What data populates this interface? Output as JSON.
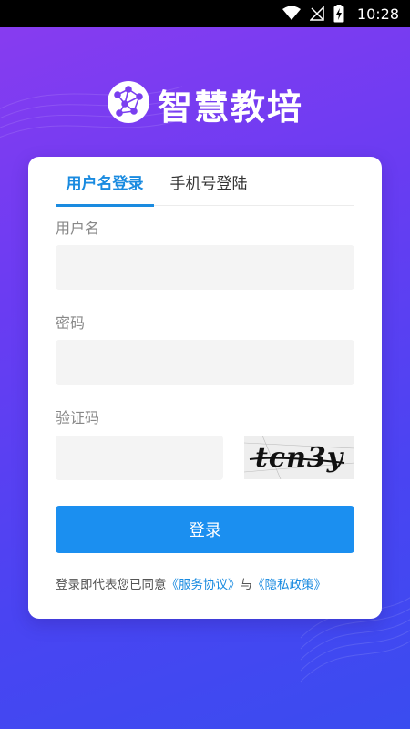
{
  "status_bar": {
    "time": "10:28",
    "icons": [
      "wifi-icon",
      "no-signal-icon",
      "battery-charging-icon"
    ]
  },
  "app": {
    "title": "智慧教培",
    "logo_icon": "network-brain-icon"
  },
  "login_tabs": [
    {
      "label": "用户名登录",
      "active": true
    },
    {
      "label": "手机号登陆",
      "active": false
    }
  ],
  "form": {
    "username_label": "用户名",
    "username_value": "",
    "password_label": "密码",
    "password_value": "",
    "captcha_label": "验证码",
    "captcha_value": "",
    "captcha_image_text": "tcn3y",
    "submit_label": "登录"
  },
  "agreement": {
    "prefix": "登录即代表您已同意",
    "service_link": "《服务协议》",
    "conjunction": "与",
    "privacy_link": "《隐私政策》"
  },
  "colors": {
    "accent": "#1a8be0",
    "button": "#1b8ff0",
    "background_start": "#8a3cf0",
    "background_end": "#3a4cf0"
  }
}
